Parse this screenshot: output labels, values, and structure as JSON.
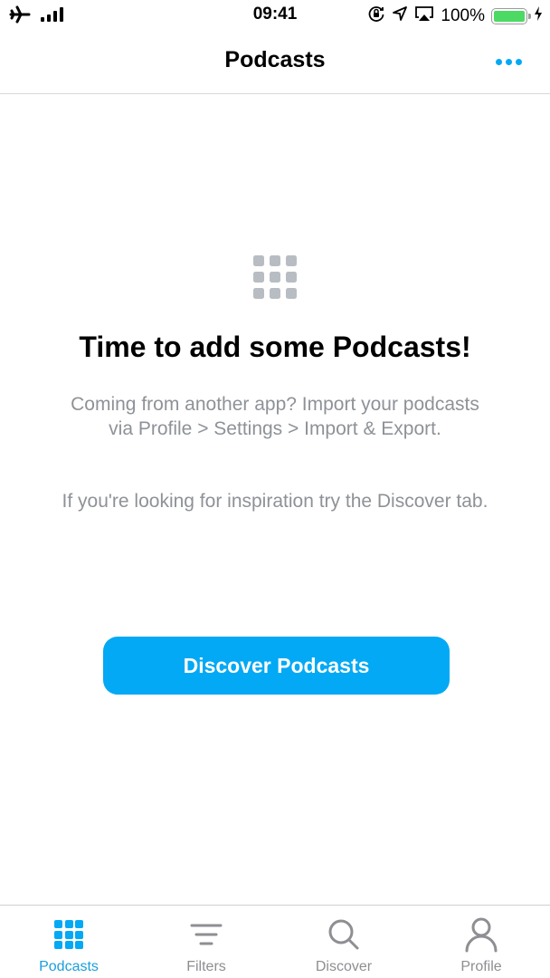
{
  "status_bar": {
    "time": "09:41",
    "battery_percent": "100%",
    "battery_level": 1.0,
    "icons": [
      "airplane-icon",
      "signal-icon",
      "orientation-lock-icon",
      "location-icon",
      "airplay-icon",
      "battery-icon",
      "charging-icon"
    ]
  },
  "nav": {
    "title": "Podcasts",
    "more_icon": "ellipsis-icon"
  },
  "empty_state": {
    "icon": "podcasts-grid-icon",
    "title": "Time to add some Podcasts!",
    "import_line1": "Coming from another app? Import your podcasts",
    "import_line2": "via Profile > Settings > Import & Export.",
    "inspiration": "If you're looking for inspiration try the Discover tab.",
    "button_label": "Discover Podcasts"
  },
  "colors": {
    "accent": "#03a9f4",
    "secondary_text": "#8e9297",
    "inactive_tab": "#8e8e93"
  },
  "tabs": [
    {
      "label": "Podcasts",
      "icon": "grid-icon",
      "active": true
    },
    {
      "label": "Filters",
      "icon": "filter-icon",
      "active": false
    },
    {
      "label": "Discover",
      "icon": "search-icon",
      "active": false
    },
    {
      "label": "Profile",
      "icon": "profile-icon",
      "active": false
    }
  ]
}
